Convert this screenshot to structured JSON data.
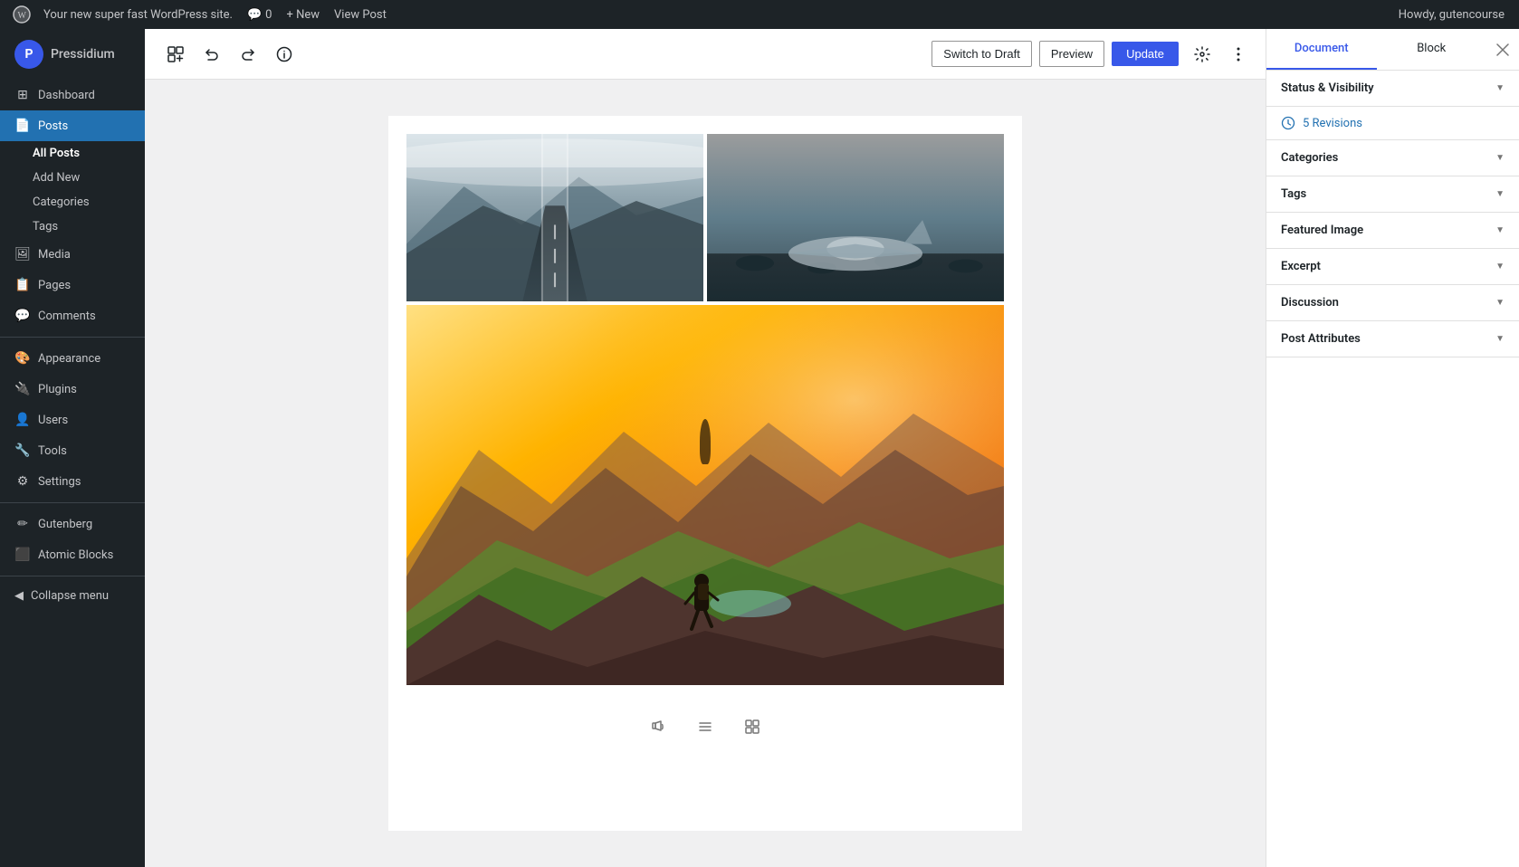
{
  "adminbar": {
    "site_name": "Your new super fast WordPress site.",
    "comments_count": "0",
    "new_label": "+ New",
    "view_post_label": "View Post",
    "howdy": "Howdy, gutencourse"
  },
  "sidebar": {
    "brand_name": "Pressidium",
    "items": [
      {
        "id": "dashboard",
        "label": "Dashboard",
        "icon": "⊞"
      },
      {
        "id": "posts",
        "label": "Posts",
        "icon": "📄"
      },
      {
        "id": "media",
        "label": "Media",
        "icon": "🖼"
      },
      {
        "id": "pages",
        "label": "Pages",
        "icon": "📋"
      },
      {
        "id": "comments",
        "label": "Comments",
        "icon": "💬"
      },
      {
        "id": "appearance",
        "label": "Appearance",
        "icon": "🎨"
      },
      {
        "id": "plugins",
        "label": "Plugins",
        "icon": "🔌"
      },
      {
        "id": "users",
        "label": "Users",
        "icon": "👤"
      },
      {
        "id": "tools",
        "label": "Tools",
        "icon": "🔧"
      },
      {
        "id": "settings",
        "label": "Settings",
        "icon": "⚙"
      },
      {
        "id": "gutenberg",
        "label": "Gutenberg",
        "icon": "✏"
      },
      {
        "id": "atomic-blocks",
        "label": "Atomic Blocks",
        "icon": "⬛"
      }
    ],
    "posts_sub_items": [
      {
        "id": "all-posts",
        "label": "All Posts"
      },
      {
        "id": "add-new",
        "label": "Add New"
      },
      {
        "id": "categories",
        "label": "Categories"
      },
      {
        "id": "tags",
        "label": "Tags"
      }
    ],
    "collapse_label": "Collapse menu"
  },
  "toolbar": {
    "add_block_title": "Add block",
    "undo_title": "Undo",
    "redo_title": "Redo",
    "info_title": "Information",
    "switch_draft_label": "Switch to Draft",
    "preview_label": "Preview",
    "update_label": "Update",
    "settings_title": "Settings",
    "more_title": "More tools and options"
  },
  "right_panel": {
    "document_tab": "Document",
    "block_tab": "Block",
    "close_title": "Close settings",
    "sections": [
      {
        "id": "status-visibility",
        "label": "Status & Visibility"
      },
      {
        "id": "revisions",
        "label": "Revisions",
        "count": 5,
        "revisions_label": "5 Revisions"
      },
      {
        "id": "categories",
        "label": "Categories"
      },
      {
        "id": "tags",
        "label": "Tags"
      },
      {
        "id": "featured-image",
        "label": "Featured Image"
      },
      {
        "id": "excerpt",
        "label": "Excerpt"
      },
      {
        "id": "discussion",
        "label": "Discussion"
      },
      {
        "id": "post-attributes",
        "label": "Post Attributes"
      }
    ]
  },
  "gallery": {
    "bottom_icons": [
      {
        "id": "audio",
        "symbol": "♪"
      },
      {
        "id": "list",
        "symbol": "≡"
      },
      {
        "id": "image",
        "symbol": "▣"
      }
    ]
  }
}
